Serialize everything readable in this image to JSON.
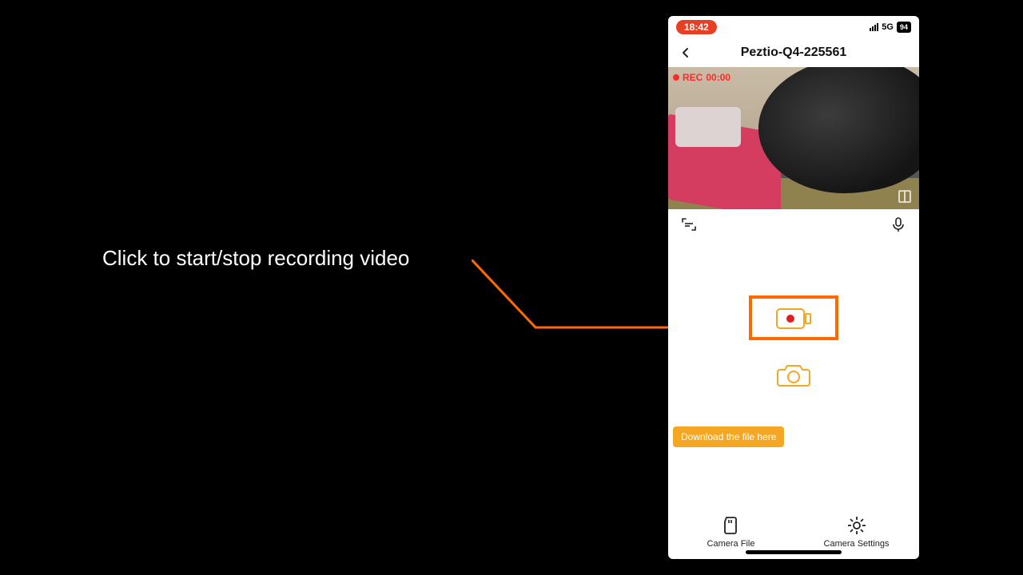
{
  "annotation": {
    "text": "Click to start/stop recording video"
  },
  "statusbar": {
    "time": "18:42",
    "network": "5G",
    "battery": "94"
  },
  "navbar": {
    "title": "Peztio-Q4-225561"
  },
  "preview": {
    "rec_label": "REC",
    "rec_timer": "00:00"
  },
  "tooltip": {
    "download": "Download the file here"
  },
  "tabs": {
    "camera_file": "Camera File",
    "camera_settings": "Camera Settings"
  },
  "colors": {
    "highlight": "#ff6a00",
    "tooltip_bg": "#f5a623",
    "time_pill": "#e83e24",
    "rec_red": "#ff2a2a",
    "icon_orange": "#f5a623"
  }
}
